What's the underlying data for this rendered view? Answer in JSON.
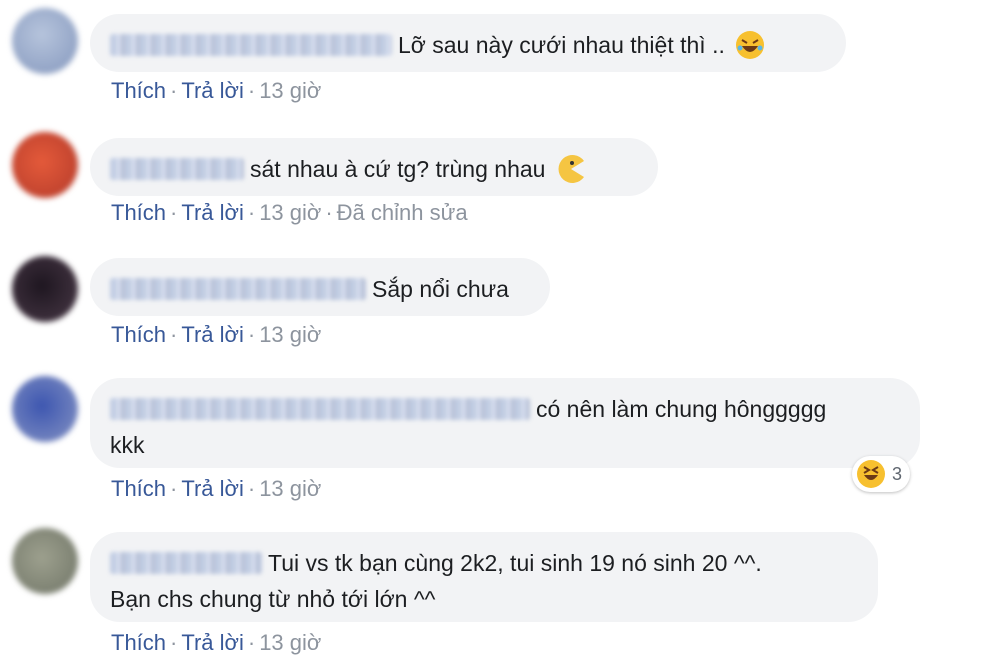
{
  "comments": [
    {
      "text": "Lỡ sau này cưới nhau thiệt thì ..",
      "emoji": "rofl-emoji",
      "actions": {
        "like": "Thích",
        "reply": "Trả lời",
        "time": "13 giờ"
      },
      "avatar_color": "#9fb0cc"
    },
    {
      "text": "sát nhau à cứ tg? trùng nhau",
      "emoji": "pacman-emoji",
      "actions": {
        "like": "Thích",
        "reply": "Trả lời",
        "time": "13 giờ",
        "edited": "Đã chỉnh sửa"
      },
      "avatar_color": "#d8452f"
    },
    {
      "text": "Sắp nổi chưa",
      "actions": {
        "like": "Thích",
        "reply": "Trả lời",
        "time": "13 giờ"
      },
      "avatar_color": "#3a2e3a"
    },
    {
      "text": "có nên làm chung hônggggg",
      "text_line2": "kkk",
      "actions": {
        "like": "Thích",
        "reply": "Trả lời",
        "time": "13 giờ"
      },
      "reaction": {
        "icon": "laughing-emoji",
        "count": "3"
      },
      "avatar_color": "#5a72b8"
    },
    {
      "text": "Tui vs tk bạn cùng 2k2, tui sinh 19 nó sinh 20 ^^.",
      "text_line2": "Bạn chs chung từ nhỏ tới lớn ^^",
      "actions": {
        "like": "Thích",
        "reply": "Trả lời",
        "time": "13 giờ"
      },
      "avatar_color": "#8a8f7e"
    }
  ],
  "separator": "·"
}
